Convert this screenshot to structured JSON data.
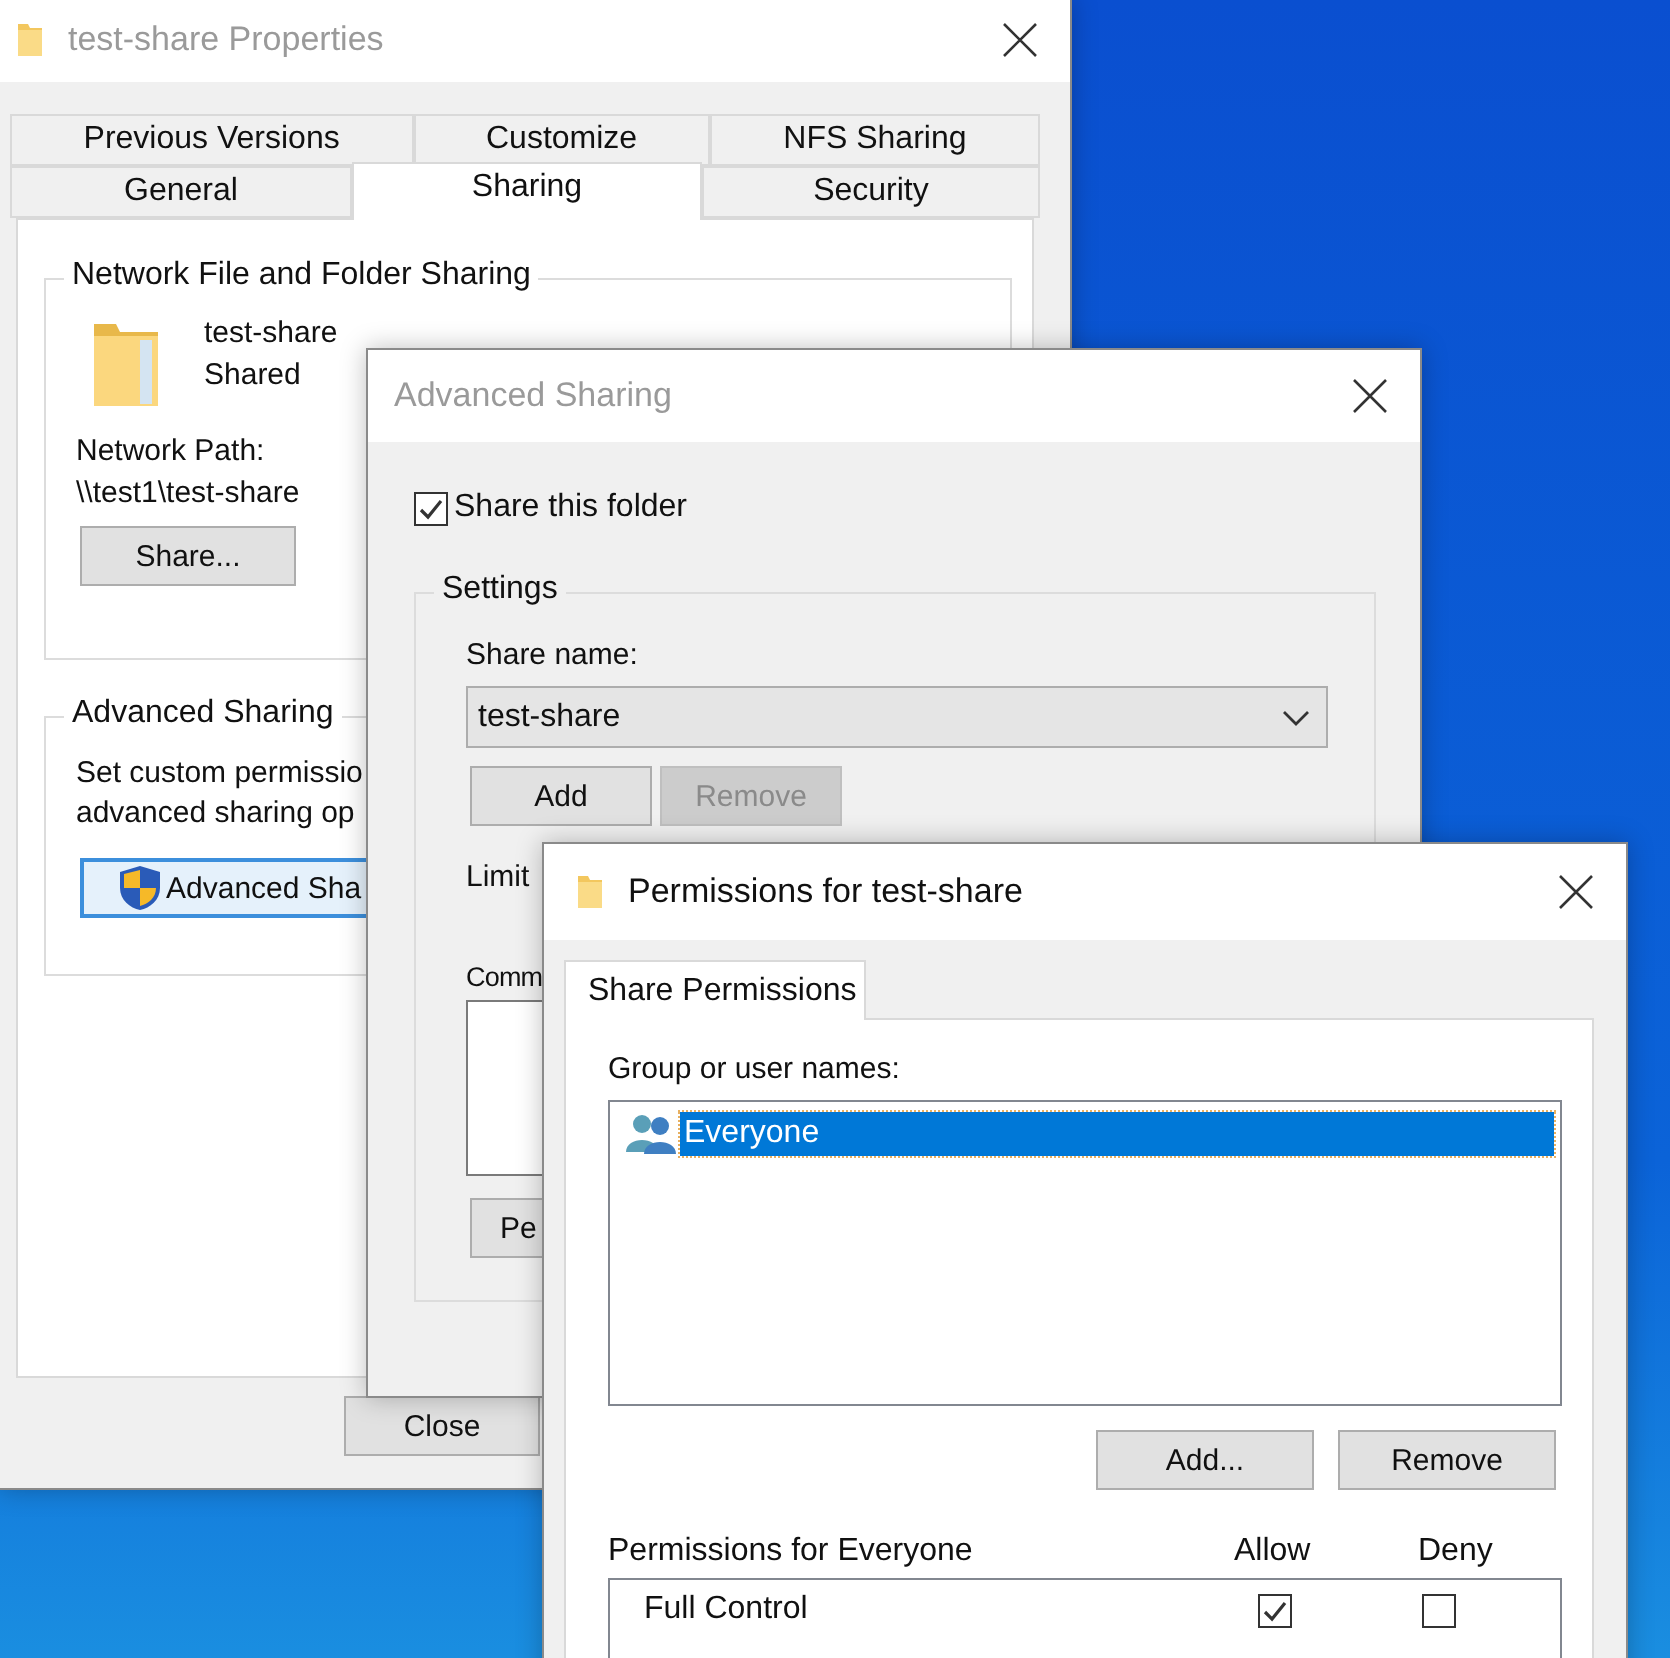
{
  "properties_window": {
    "title": "test-share Properties",
    "tab_rows": [
      [
        {
          "label": "Previous Versions",
          "selected": false
        },
        {
          "label": "Customize",
          "selected": false
        },
        {
          "label": "NFS Sharing",
          "selected": false
        }
      ],
      [
        {
          "label": "General",
          "selected": false
        },
        {
          "label": "Sharing",
          "selected": true
        },
        {
          "label": "Security",
          "selected": false
        }
      ]
    ],
    "network_sharing": {
      "heading": "Network File and Folder Sharing",
      "folder_name": "test-share",
      "status": "Shared",
      "path_label": "Network Path:",
      "path": "\\\\test1\\test-share",
      "share_button": "Share..."
    },
    "advanced_sharing": {
      "heading": "Advanced Sharing",
      "description_lines": [
        "Set custom permissio",
        "advanced sharing op"
      ],
      "button": "Advanced Sha"
    },
    "close_button": "Close"
  },
  "advanced_sharing_window": {
    "title": "Advanced Sharing",
    "share_checkbox": {
      "label": "Share this folder",
      "checked": true
    },
    "settings": {
      "heading": "Settings",
      "share_name_label": "Share name:",
      "share_name": "test-share",
      "buttons": [
        {
          "label": "Add",
          "disabled": false
        },
        {
          "label": "Remove",
          "disabled": true
        }
      ],
      "limit_label": "Limit",
      "comments_label": "Comm",
      "permissions_button": "Pe"
    }
  },
  "permissions_window": {
    "title": "Permissions for test-share",
    "tabs": [
      {
        "label": "Share Permissions",
        "selected": true
      }
    ],
    "group_label": "Group or user names:",
    "users": [
      {
        "name": "Everyone",
        "selected": true
      }
    ],
    "buttons": [
      "Add...",
      "Remove"
    ],
    "permissions_label": "Permissions for Everyone",
    "columns": [
      "Allow",
      "Deny"
    ],
    "permissions": [
      {
        "name": "Full Control",
        "allow": true,
        "deny": false
      }
    ]
  }
}
